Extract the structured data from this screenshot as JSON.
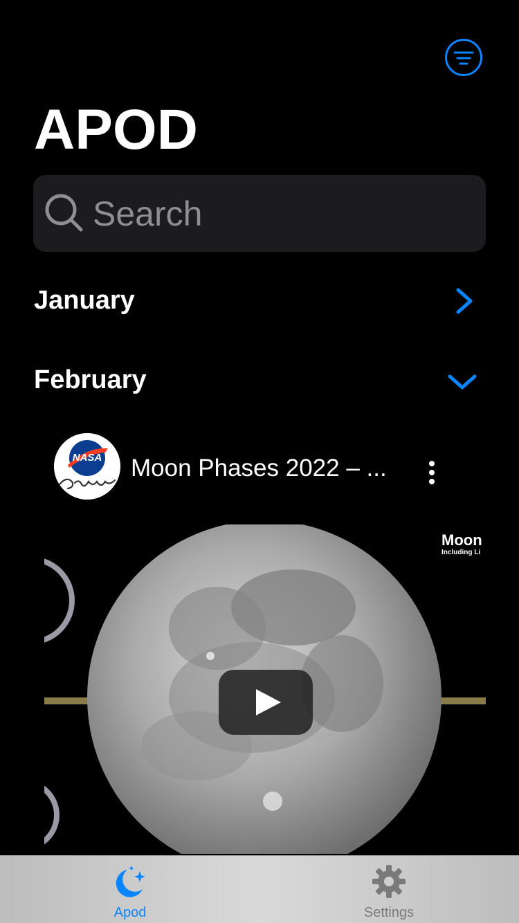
{
  "header": {
    "title": "APOD",
    "filter_icon": "filter-circle-icon"
  },
  "search": {
    "placeholder": "Search",
    "icon": "search-icon"
  },
  "months": [
    {
      "label": "January",
      "state": "collapsed",
      "icon": "chevron-right-icon"
    },
    {
      "label": "February",
      "state": "expanded",
      "icon": "chevron-down-icon"
    }
  ],
  "video_card": {
    "channel_avatar": "nasa-goddard-logo",
    "title": "Moon Phases 2022 – ...",
    "more_icon": "more-vertical-icon",
    "thumbnail": {
      "heading": "Moon",
      "subheading": "Including Li",
      "play_icon": "play-icon"
    }
  },
  "tabbar": {
    "tabs": [
      {
        "label": "Apod",
        "icon": "moon-stars-icon",
        "selected": true
      },
      {
        "label": "Settings",
        "icon": "gear-icon",
        "selected": false
      }
    ]
  },
  "colors": {
    "accent": "#0a84ff",
    "background": "#000000",
    "search_field": "#1c1c1e",
    "placeholder": "#8e8e93",
    "tab_inactive": "#7a7a7a"
  }
}
